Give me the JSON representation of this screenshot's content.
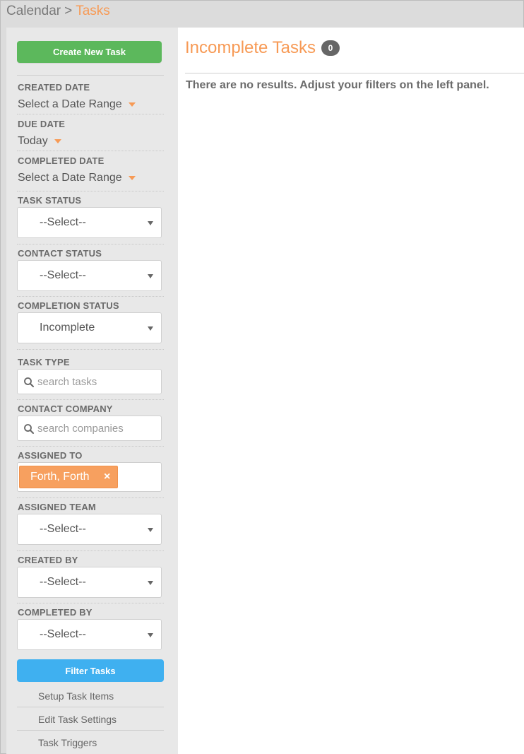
{
  "breadcrumb": {
    "parent": "Calendar",
    "separator": ">",
    "current": "Tasks"
  },
  "colors": {
    "accent": "#f79a55",
    "create_button": "#5cb85c",
    "filter_button": "#3fb0f0",
    "badge": "#666666"
  },
  "sidebar": {
    "create_button": "Create New Task",
    "created_date": {
      "label": "CREATED DATE",
      "value": "Select a Date Range"
    },
    "due_date": {
      "label": "DUE DATE",
      "value": "Today"
    },
    "completed_date": {
      "label": "COMPLETED DATE",
      "value": "Select a Date Range"
    },
    "task_status": {
      "label": "TASK STATUS",
      "value": "--Select--"
    },
    "contact_status": {
      "label": "CONTACT STATUS",
      "value": "--Select--"
    },
    "completion_status": {
      "label": "COMPLETION STATUS",
      "value": "Incomplete"
    },
    "task_type": {
      "label": "TASK TYPE",
      "placeholder": "search tasks",
      "icon": "search-icon"
    },
    "contact_company": {
      "label": "CONTACT COMPANY",
      "placeholder": "search companies",
      "icon": "search-icon"
    },
    "assigned_to": {
      "label": "ASSIGNED TO",
      "tag": "Forth, Forth",
      "remove": "×"
    },
    "assigned_team": {
      "label": "ASSIGNED TEAM",
      "value": "--Select--"
    },
    "created_by": {
      "label": "CREATED BY",
      "value": "--Select--"
    },
    "completed_by": {
      "label": "COMPLETED BY",
      "value": "--Select--"
    },
    "filter_button": "Filter Tasks",
    "links": [
      "Setup Task Items",
      "Edit Task Settings",
      "Task Triggers"
    ]
  },
  "main": {
    "title": "Incomplete Tasks",
    "count": "0",
    "empty_message": "There are no results. Adjust your filters on the left panel."
  }
}
